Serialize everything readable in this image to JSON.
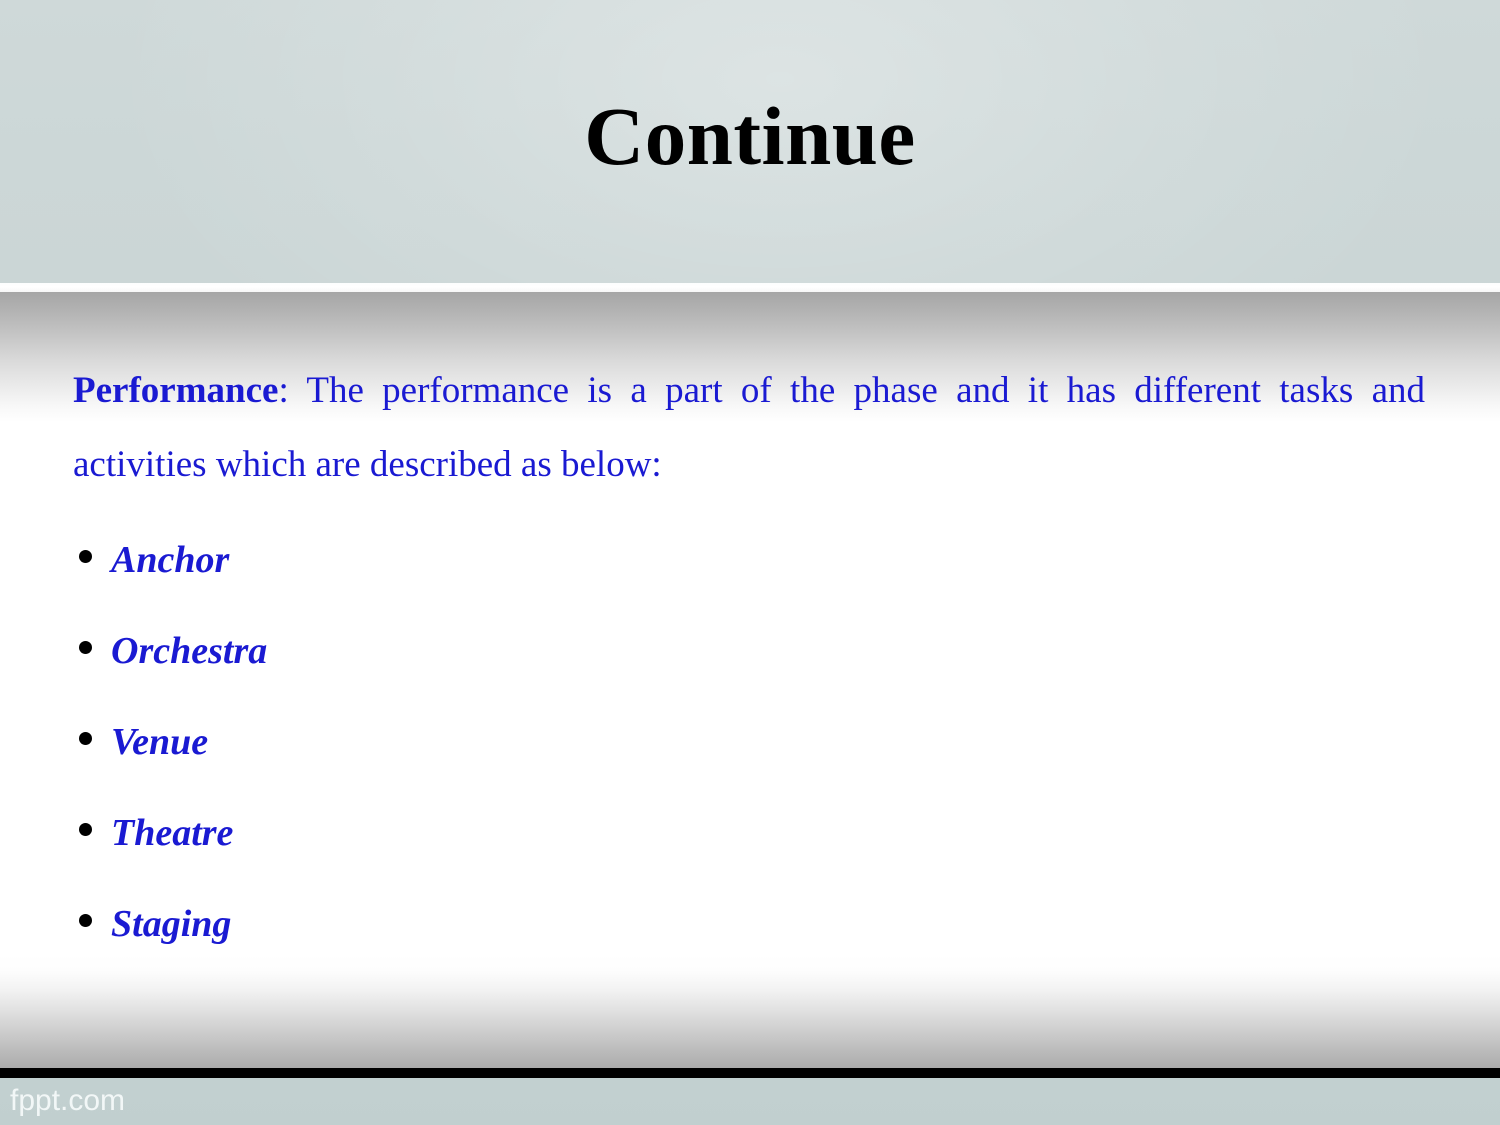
{
  "slide": {
    "title": "Continue",
    "title_color": "#000000",
    "header_bg": "#cfd9d9",
    "body_bg": "#ffffff",
    "accent_text_color": "#1a1ad2"
  },
  "content": {
    "paragraph": {
      "lead": "Performance",
      "rest": ": The performance is a part of the phase and it has different tasks and activities which are described as below:"
    },
    "bullets": [
      {
        "label": "Anchor"
      },
      {
        "label": "Orchestra"
      },
      {
        "label": "Venue"
      },
      {
        "label": "Theatre"
      },
      {
        "label": "Staging"
      }
    ]
  },
  "footer": {
    "watermark": "fppt.com",
    "watermark_color": "#f2f7f7",
    "band_color": "#c2d0d0",
    "bar_color": "#000000"
  }
}
